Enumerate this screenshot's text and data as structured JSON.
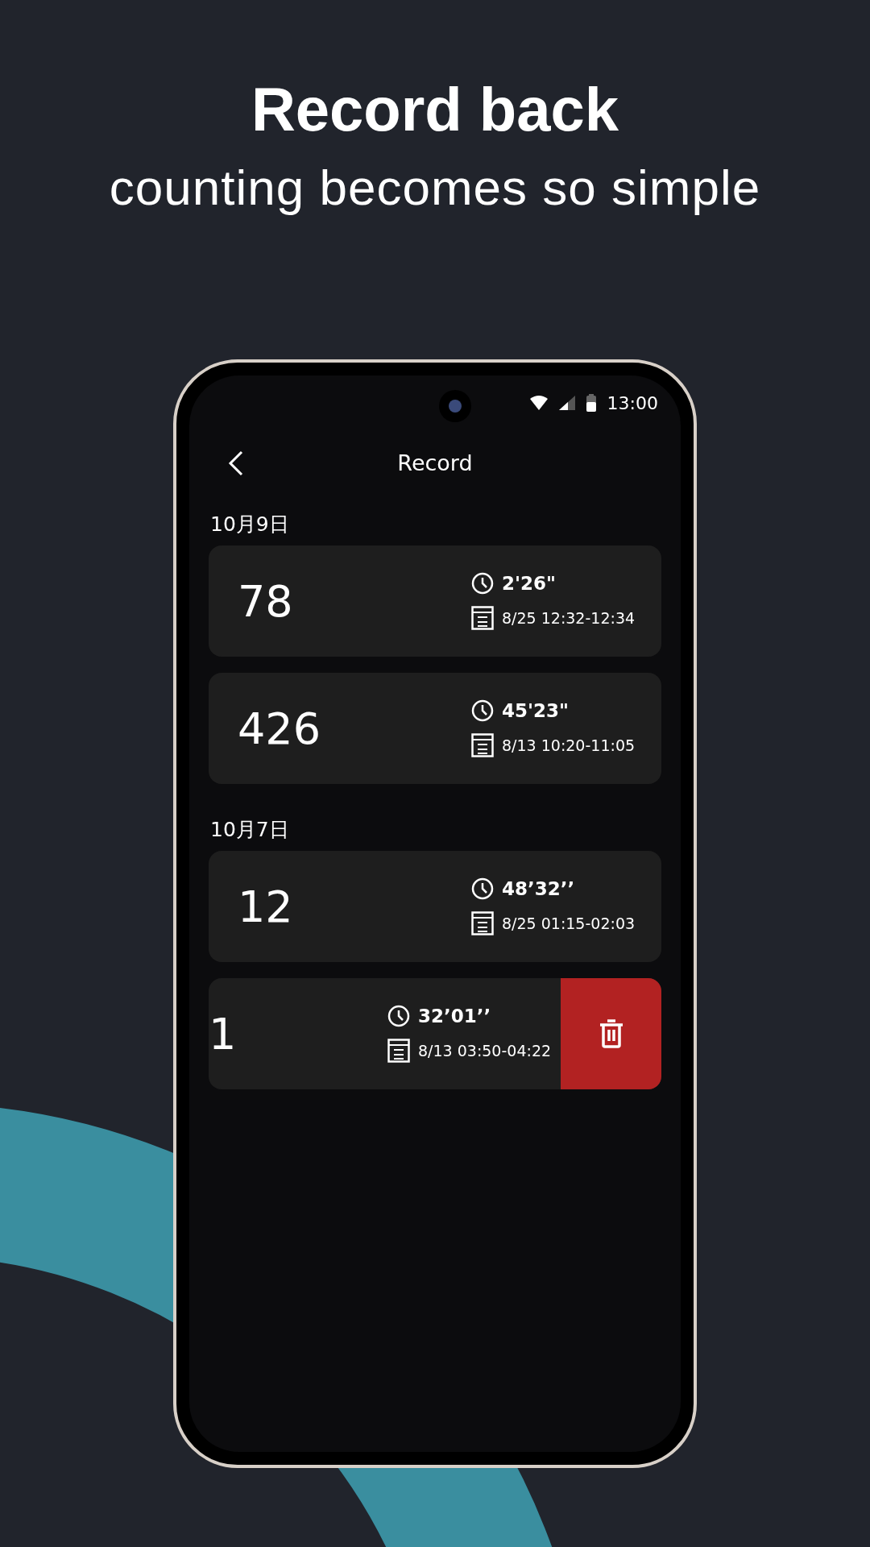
{
  "headline": "Record back",
  "subheadline": "counting becomes so simple",
  "status_bar": {
    "time": "13:00"
  },
  "header": {
    "title": "Record"
  },
  "groups": [
    {
      "date": "10月9日",
      "records": [
        {
          "count": "78",
          "duration": "2'26\"",
          "period": "8/25 12:32-12:34",
          "swiped": false
        },
        {
          "count": "426",
          "duration": "45'23\"",
          "period": "8/13 10:20-11:05",
          "swiped": false
        }
      ]
    },
    {
      "date": "10月7日",
      "records": [
        {
          "count": "12",
          "duration": "48’32’’",
          "period": "8/25 01:15-02:03",
          "swiped": false
        },
        {
          "count": "1",
          "duration": "32’01’’",
          "period": "8/13 03:50-04:22",
          "swiped": true
        }
      ]
    }
  ]
}
